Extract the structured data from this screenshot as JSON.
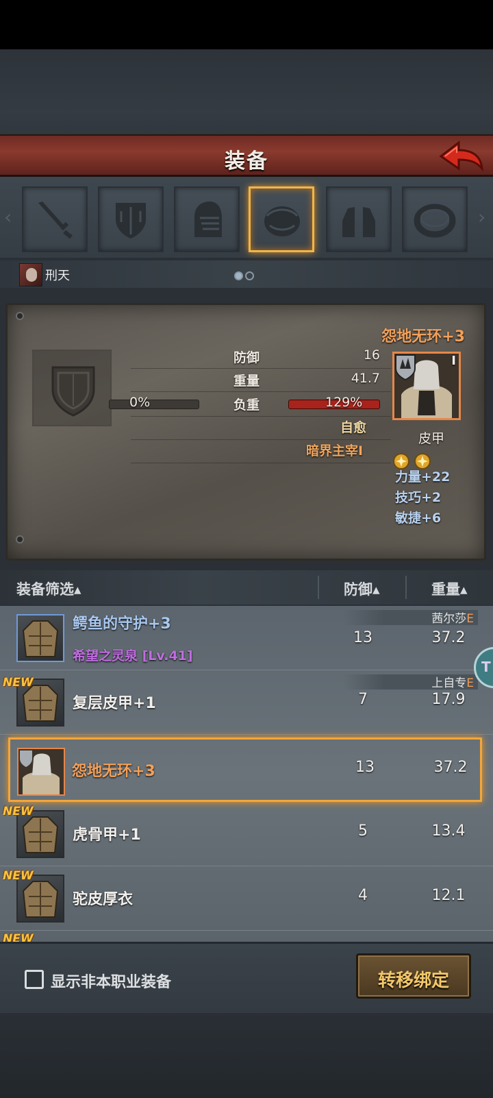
{
  "header": {
    "title": "装备"
  },
  "slots": [
    {
      "name": "weapon-slot",
      "icon": "sword-icon"
    },
    {
      "name": "shield-slot",
      "icon": "shield-icon"
    },
    {
      "name": "helmet-slot",
      "icon": "helmet-icon"
    },
    {
      "name": "armor-slot",
      "icon": "armor-icon",
      "active": true
    },
    {
      "name": "boots-slot",
      "icon": "boots-icon"
    },
    {
      "name": "ring-slot",
      "icon": "ring-icon"
    }
  ],
  "hero": {
    "name": "刑天",
    "page": 1,
    "pages": 2
  },
  "panel": {
    "stats": {
      "defense_label": "防御",
      "defense_value": "16",
      "weight_label": "重量",
      "weight_value": "41.7",
      "load_label": "负重",
      "load_left": "0%",
      "load_right": "129%",
      "load_left_fraction": 0,
      "load_right_fraction": 1
    },
    "skills": {
      "skill1": "自愈",
      "skill2": "暗界主宰I"
    },
    "equipped": {
      "name": "怨地无环+3",
      "type": "皮甲",
      "tier": "I",
      "bonuses": [
        "力量+22",
        "技巧+2",
        "敏捷+6"
      ],
      "gem_color": "#e0a52a"
    }
  },
  "list_header": {
    "filter": "装备筛选▴",
    "defense": "防御▴",
    "weight": "重量▴"
  },
  "items": [
    {
      "name": "鳄鱼的守护+3",
      "sub": "希望之灵泉 [Lv.41]",
      "defense": "13",
      "weight": "37.2",
      "owner": "茜尔莎",
      "owner_grade": "E",
      "new": false,
      "rarity": "blue"
    },
    {
      "name": "复层皮甲+1",
      "sub": "",
      "defense": "7",
      "weight": "17.9",
      "owner": "上自专",
      "owner_grade": "E",
      "new": true,
      "rarity": "normal"
    },
    {
      "name": "怨地无环+3",
      "sub": "",
      "defense": "13",
      "weight": "37.2",
      "owner": "",
      "owner_grade": "",
      "new": false,
      "rarity": "orange",
      "selected": true
    },
    {
      "name": "虎骨甲+1",
      "sub": "",
      "defense": "5",
      "weight": "13.4",
      "owner": "",
      "owner_grade": "",
      "new": true,
      "rarity": "normal"
    },
    {
      "name": "驼皮厚衣",
      "sub": "",
      "defense": "4",
      "weight": "12.1",
      "owner": "",
      "owner_grade": "",
      "new": true,
      "rarity": "normal"
    }
  ],
  "new_tag": "NEW",
  "side_bubble": "T",
  "footer": {
    "show_other_class": "显示非本职业装备",
    "transfer_button": "转移绑定"
  },
  "colors": {
    "accent": "#f4a63a",
    "header": "#7a3127",
    "rare_orange": "#f2a05a",
    "rare_blue": "#a9c8f0",
    "purple": "#c06de0"
  }
}
